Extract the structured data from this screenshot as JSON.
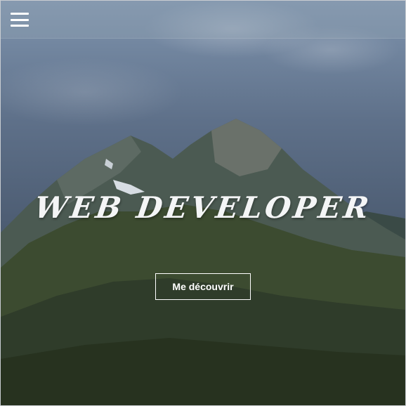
{
  "header": {
    "menu_icon": "hamburger-menu-icon"
  },
  "hero": {
    "title": "WEB DEVELOPER",
    "button_label": "Me découvrir"
  },
  "colors": {
    "text": "#ffffff",
    "sky": "#5e7089",
    "forest": "#2f3c2a"
  }
}
